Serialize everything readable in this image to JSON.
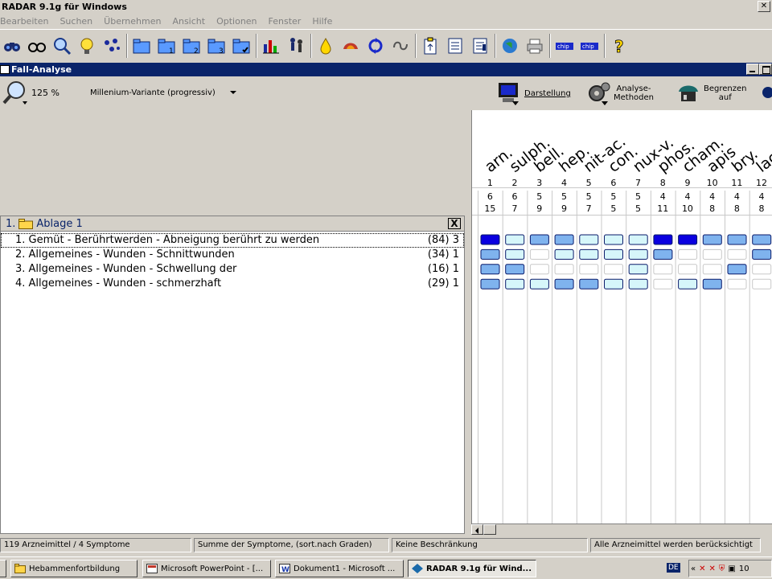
{
  "app": {
    "title": "RADAR 9.1g für Windows",
    "close_glyph": "✕"
  },
  "menu": [
    "Bearbeiten",
    "Suchen",
    "Übernehmen",
    "Ansicht",
    "Optionen",
    "Fenster",
    "Hilfe"
  ],
  "toolbar": {
    "icons": [
      "binoculars-icon",
      "glasses-icon",
      "magnifier-icon",
      "lightbulb-icon",
      "dots-icon",
      "folder-open-icon",
      "folder-1-icon",
      "folder-2-icon",
      "folder-3-icon",
      "folder-check-icon",
      "bar-chart-icon",
      "figures-icon",
      "drop-icon",
      "flame-icon",
      "cycle-icon",
      "knot-icon",
      "clipboard-up-icon",
      "list-in-icon",
      "list-out-icon",
      "globe-icon",
      "printer-icon",
      "dice-icon",
      "dice-2-icon",
      "help-icon"
    ]
  },
  "child_window": {
    "title": "Fall-Analyse"
  },
  "row2": {
    "zoom": "125 %",
    "variant": "Millenium-Variante (progressiv)",
    "darstellung": "Darstellung",
    "analyse_line1": "Analyse-",
    "analyse_line2": "Methoden",
    "begrenzen_line1": "Begrenzen",
    "begrenzen_line2": "auf"
  },
  "pane": {
    "header": "Ablage 1",
    "header_num": "1.",
    "close": "X",
    "symptoms": [
      {
        "label": "1. Gemüt - Berührtwerden - Abneigung berührt zu werden",
        "count": "(84) 3"
      },
      {
        "label": "2. Allgemeines - Wunden - Schnittwunden",
        "count": "(34) 1"
      },
      {
        "label": "3. Allgemeines - Wunden - Schwellung der",
        "count": "(16) 1"
      },
      {
        "label": "4. Allgemeines - Wunden - schmerzhaft",
        "count": "(29) 1"
      }
    ]
  },
  "grid": {
    "remedies": [
      {
        "name": "arn.",
        "rank": "1",
        "top": "6",
        "bottom": "15"
      },
      {
        "name": "sulph.",
        "rank": "2",
        "top": "6",
        "bottom": "7"
      },
      {
        "name": "bell.",
        "rank": "3",
        "top": "5",
        "bottom": "9"
      },
      {
        "name": "hep.",
        "rank": "4",
        "top": "5",
        "bottom": "9"
      },
      {
        "name": "nit-ac.",
        "rank": "5",
        "top": "5",
        "bottom": "7"
      },
      {
        "name": "con.",
        "rank": "6",
        "top": "5",
        "bottom": "5"
      },
      {
        "name": "nux-v.",
        "rank": "7",
        "top": "5",
        "bottom": "5"
      },
      {
        "name": "phos.",
        "rank": "8",
        "top": "4",
        "bottom": "11"
      },
      {
        "name": "cham.",
        "rank": "9",
        "top": "4",
        "bottom": "10"
      },
      {
        "name": "apis",
        "rank": "10",
        "top": "4",
        "bottom": "8"
      },
      {
        "name": "bry.",
        "rank": "11",
        "top": "4",
        "bottom": "8"
      },
      {
        "name": "lach.",
        "rank": "12",
        "top": "4",
        "bottom": "8"
      }
    ],
    "grades": [
      [
        4,
        1,
        2,
        2,
        1,
        1,
        1,
        4,
        4,
        2,
        2,
        2
      ],
      [
        2,
        1,
        0,
        1,
        1,
        1,
        1,
        2,
        0,
        0,
        0,
        2
      ],
      [
        2,
        2,
        0,
        0,
        0,
        0,
        1,
        0,
        0,
        0,
        2,
        0
      ],
      [
        2,
        1,
        1,
        2,
        2,
        1,
        1,
        0,
        1,
        2,
        0,
        0
      ]
    ],
    "colors": {
      "grade4": "#0a00e0",
      "grade2": "#7fb3ee",
      "grade1": "#d6f6fa",
      "grade0": "#ffffff"
    }
  },
  "status": {
    "s1": "119 Arzneimittel / 4 Symptome",
    "s2": "Summe der Symptome, (sort.nach Graden)",
    "s3": "Keine Beschränkung",
    "s4": "Alle Arzneimittel werden berücksichtigt"
  },
  "taskbar": {
    "buttons": [
      {
        "label": "Hebammenfortbildung"
      },
      {
        "label": "Microsoft PowerPoint - [..."
      },
      {
        "label": "Dokument1 - Microsoft ..."
      },
      {
        "label": "RADAR 9.1g für Wind..."
      }
    ],
    "lang": "DE",
    "tray_arrows": "«",
    "clock": "10"
  }
}
